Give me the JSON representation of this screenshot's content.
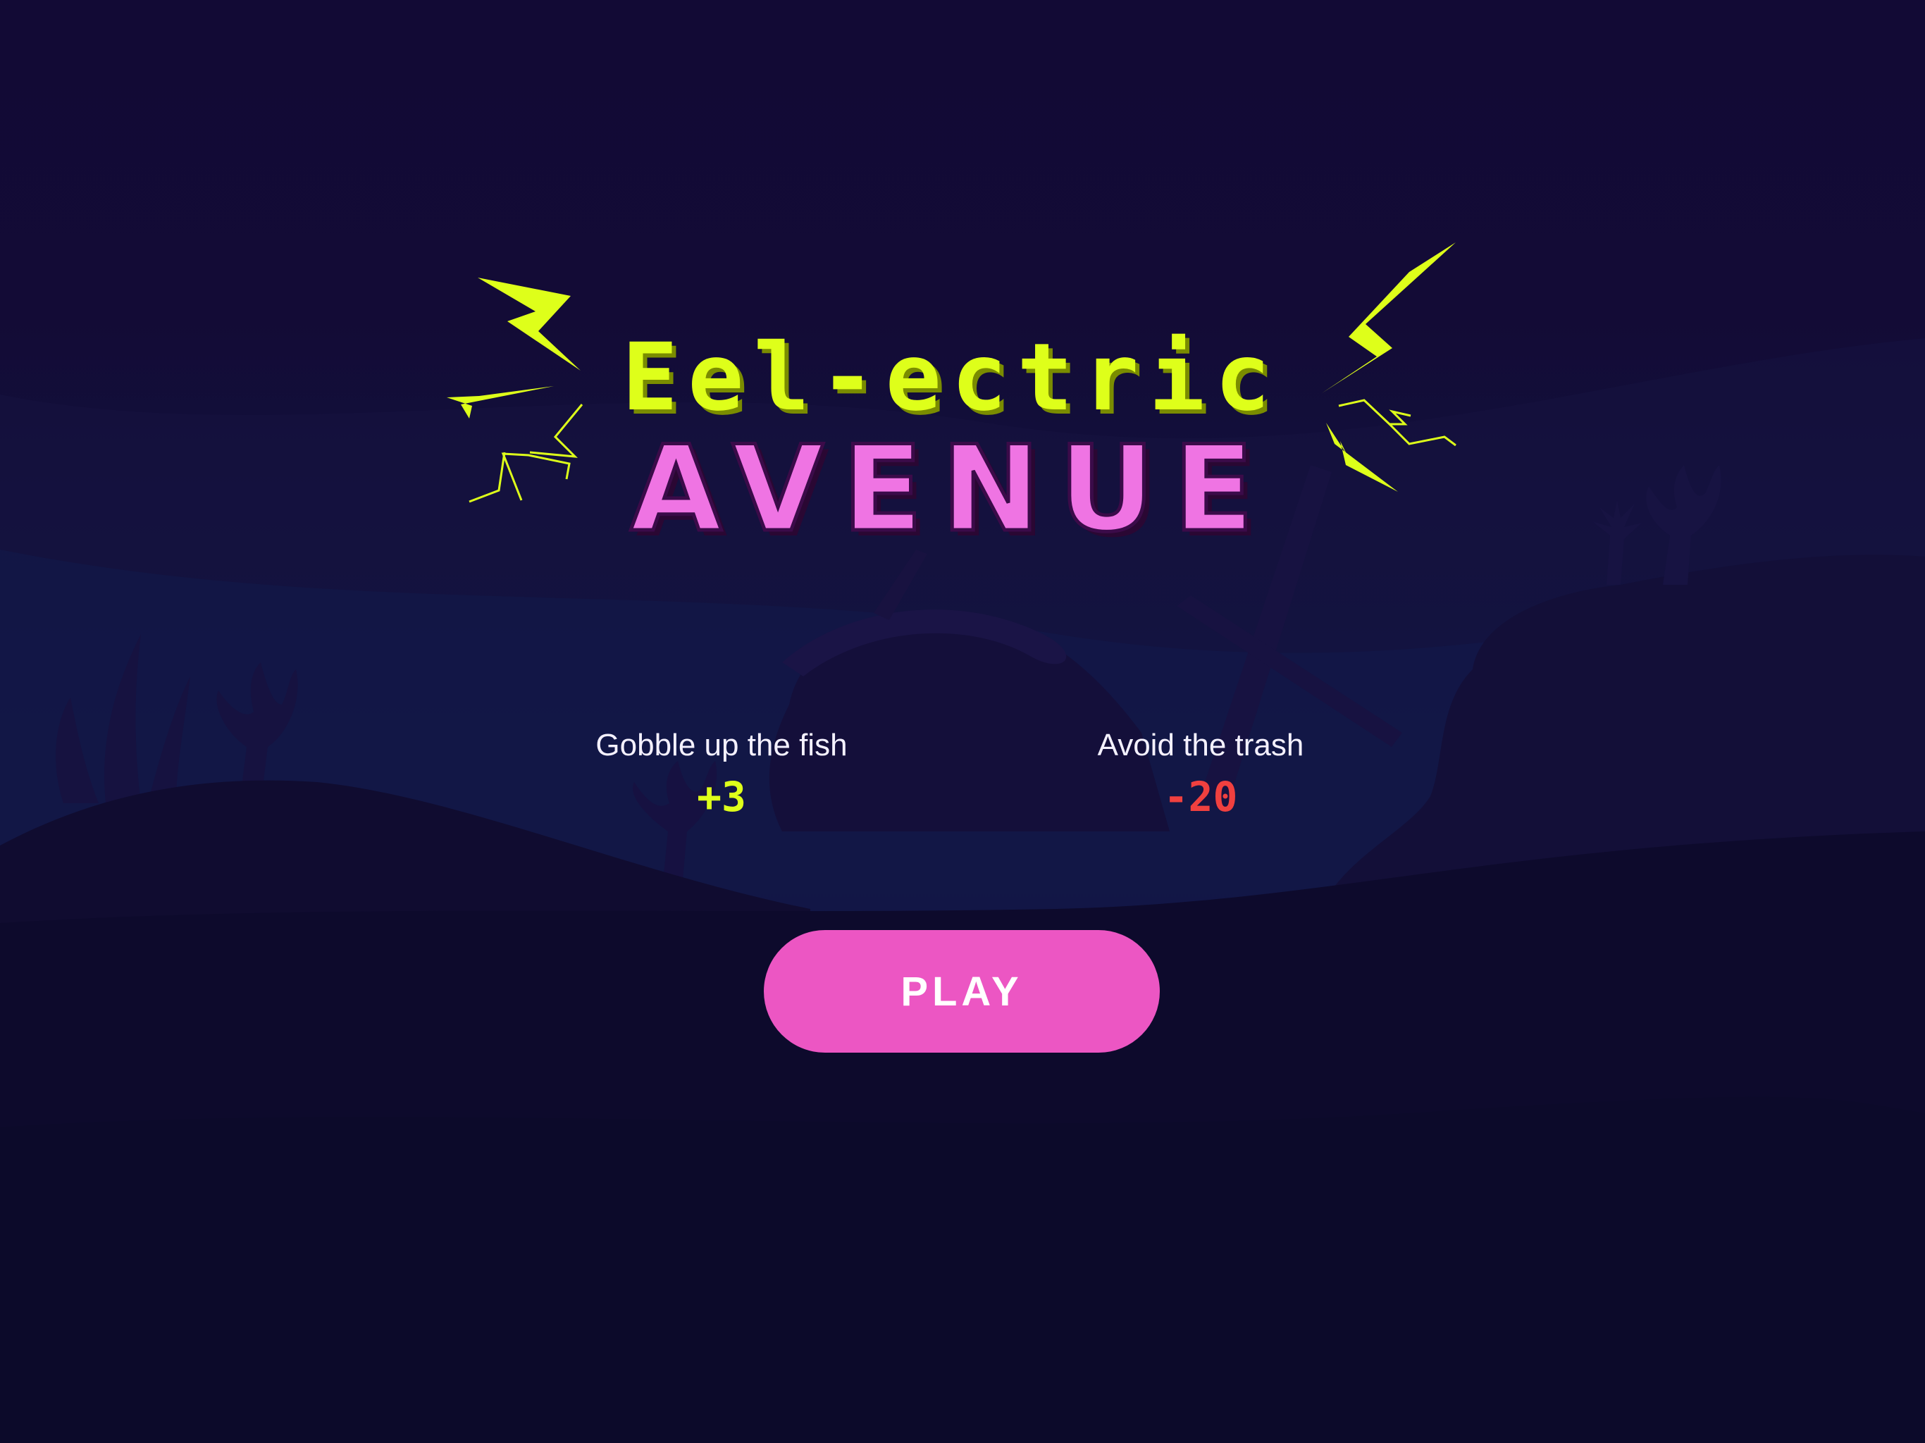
{
  "title": {
    "line1": "Eel-ectric",
    "line2": "AVENUE"
  },
  "rules": [
    {
      "label": "Gobble up the fish",
      "points": "+3",
      "color": "#deff1a"
    },
    {
      "label": "Avoid the trash",
      "points": "-20",
      "color": "#f0403f"
    }
  ],
  "play_button": {
    "label": "PLAY"
  },
  "colors": {
    "accent_yellow": "#deff1a",
    "accent_pink": "#ec56c3",
    "title_pink": "#ef74e3",
    "negative_red": "#f0403f",
    "background": "#120a35"
  },
  "scenery": [
    "seaweed",
    "sunken-ship",
    "rock-hill",
    "coral"
  ]
}
